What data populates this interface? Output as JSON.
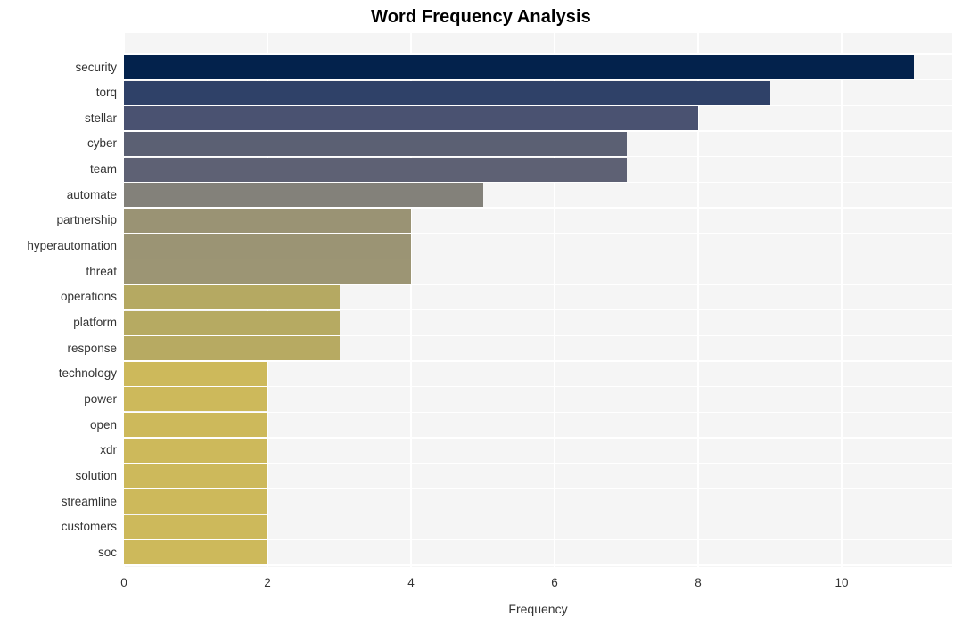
{
  "chart_data": {
    "type": "bar",
    "orientation": "horizontal",
    "title": "Word Frequency Analysis",
    "xlabel": "Frequency",
    "ylabel": "",
    "categories": [
      "security",
      "torq",
      "stellar",
      "cyber",
      "team",
      "automate",
      "partnership",
      "hyperautomation",
      "threat",
      "operations",
      "platform",
      "response",
      "technology",
      "power",
      "open",
      "xdr",
      "solution",
      "streamline",
      "customers",
      "soc"
    ],
    "values": [
      11,
      9,
      8,
      7,
      7,
      5,
      4,
      4,
      4,
      3,
      3,
      3,
      2,
      2,
      2,
      2,
      2,
      2,
      2,
      2
    ],
    "bar_colors": [
      "#03224c",
      "#2f4168",
      "#4a5271",
      "#5b6073",
      "#5e6174",
      "#83817a",
      "#9a9374",
      "#9b9474",
      "#9c9574",
      "#b5a962",
      "#b6aa62",
      "#b7aa62",
      "#cdb95b",
      "#cdb95b",
      "#cdb95b",
      "#cdb95b",
      "#cdb95b",
      "#cdb95b",
      "#cdb95b",
      "#cdb95b"
    ],
    "xticks": [
      0,
      2,
      4,
      6,
      8,
      10
    ],
    "xtick_labels": [
      "0",
      "2",
      "4",
      "6",
      "8",
      "10"
    ],
    "xlim": [
      0,
      11.54
    ],
    "grid": true,
    "legend": false,
    "plot_background": "#f5f5f5",
    "figure_background": "#ffffff",
    "gridline_color": "#ffffff",
    "tick_label_color": "#333333",
    "title_color": "#000000"
  }
}
